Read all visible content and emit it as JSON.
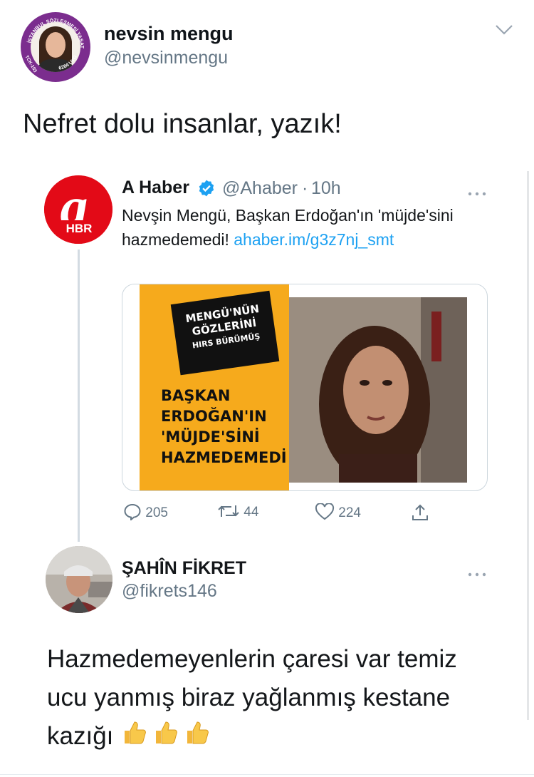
{
  "author": {
    "name": "nevsin mengu",
    "handle": "@nevsinmengu",
    "avatar_ring_text": "İSTANBUL SÖZLEŞMESİ YAŞATIR",
    "avatar_ring_bottom": "6284 UYGULA",
    "avatar_ring_left": "TCK-103",
    "avatar_icon": "profile-photo"
  },
  "tweet": {
    "text": "Nefret dolu insanlar, yazık!"
  },
  "quoted": {
    "name": "A Haber",
    "handle": "@Ahaber",
    "separator": "·",
    "time": "10h",
    "text_plain": "Nevşin Mengü, Başkan Erdoğan'ın 'müjde'sini hazmedemedi!",
    "text_link": "ahaber.im/g3z7nj_smt",
    "avatar_letter": "a",
    "avatar_label": "HBR",
    "card": {
      "box_line1": "MENGÜ'NÜN",
      "box_line2": "GÖZLERİNİ",
      "box_line3": "HIRS BÜRÜMÜŞ",
      "headline1": "BAŞKAN",
      "headline2": "ERDOĞAN'IN",
      "headline3": "'MÜJDE'SİNİ",
      "headline4": "HAZMEDEMEDİ"
    },
    "actions": {
      "replies": "205",
      "retweets": "44",
      "likes": "224"
    }
  },
  "reply": {
    "name": "ŞAHÎN FİKRET",
    "handle": "@fikrets146",
    "text": "Hazmedemeyenlerin çaresi var temiz ucu yanmış biraz yağlanmış kestane kazığı"
  },
  "colors": {
    "link": "#1da1f2",
    "secondary_text": "#657786",
    "card_yellow": "#f6aa1c",
    "ahaber_red": "#e30a17",
    "verified_blue": "#1da1f2"
  }
}
